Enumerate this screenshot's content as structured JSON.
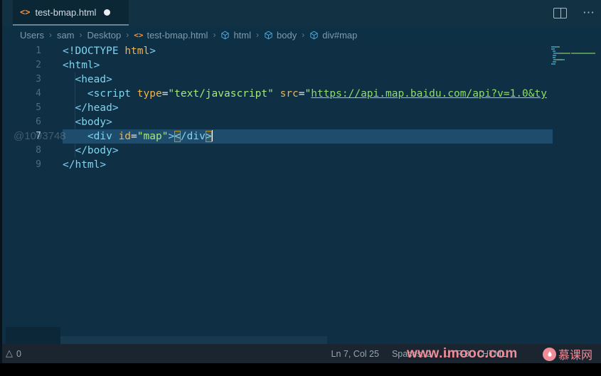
{
  "tab": {
    "title": "test-bmap.html",
    "modified": true
  },
  "editor_actions": {
    "split_label": "Split Editor",
    "more_label": "More Actions"
  },
  "breadcrumb": {
    "items": [
      {
        "label": "Users",
        "icon": null
      },
      {
        "label": "sam",
        "icon": null
      },
      {
        "label": "Desktop",
        "icon": null
      },
      {
        "label": "test-bmap.html",
        "icon": "code"
      },
      {
        "label": "html",
        "icon": "cube"
      },
      {
        "label": "body",
        "icon": "cube"
      },
      {
        "label": "div#map",
        "icon": "cube"
      }
    ],
    "separator": "›"
  },
  "editor": {
    "current_line": 7,
    "lines": [
      {
        "num": 1,
        "tokens": [
          {
            "t": "<!DOCTYPE ",
            "c": "tag"
          },
          {
            "t": "html",
            "c": "attr"
          },
          {
            "t": ">",
            "c": "tag"
          }
        ]
      },
      {
        "num": 2,
        "tokens": [
          {
            "t": "<html>",
            "c": "tag"
          }
        ]
      },
      {
        "num": 3,
        "tokens": [
          {
            "t": "  ",
            "c": "plain"
          },
          {
            "t": "<head>",
            "c": "tag"
          }
        ]
      },
      {
        "num": 4,
        "tokens": [
          {
            "t": "    ",
            "c": "plain"
          },
          {
            "t": "<script ",
            "c": "tag"
          },
          {
            "t": "type",
            "c": "attr"
          },
          {
            "t": "=",
            "c": "eq"
          },
          {
            "t": "\"text/javascript\"",
            "c": "str"
          },
          {
            "t": " ",
            "c": "plain"
          },
          {
            "t": "src",
            "c": "attr"
          },
          {
            "t": "=",
            "c": "eq"
          },
          {
            "t": "\"",
            "c": "str"
          },
          {
            "t": "https://api.map.baidu.com/api?v=1.0&ty",
            "c": "link"
          }
        ]
      },
      {
        "num": 5,
        "tokens": [
          {
            "t": "  ",
            "c": "plain"
          },
          {
            "t": "</head>",
            "c": "tag"
          }
        ]
      },
      {
        "num": 6,
        "tokens": [
          {
            "t": "  ",
            "c": "plain"
          },
          {
            "t": "<body>",
            "c": "tag"
          }
        ]
      },
      {
        "num": 7,
        "tokens": [
          {
            "t": "    ",
            "c": "plain"
          },
          {
            "t": "<div ",
            "c": "tag"
          },
          {
            "t": "id",
            "c": "attr"
          },
          {
            "t": "=",
            "c": "eq"
          },
          {
            "t": "\"map\"",
            "c": "str"
          },
          {
            "t": ">",
            "c": "tag"
          },
          {
            "t": "<",
            "c": "bracket"
          },
          {
            "t": "/div",
            "c": "tag"
          },
          {
            "t": ">",
            "c": "bracket"
          },
          {
            "t": "",
            "c": "cursor"
          }
        ]
      },
      {
        "num": 8,
        "tokens": [
          {
            "t": "  ",
            "c": "plain"
          },
          {
            "t": "</body>",
            "c": "tag"
          }
        ]
      },
      {
        "num": 9,
        "tokens": [
          {
            "t": "</html>",
            "c": "tag"
          }
        ]
      }
    ]
  },
  "status_bar": {
    "problems": "0",
    "position": "Ln 7, Col 25",
    "indent": "Spaces: 2",
    "encoding": "UTF-8",
    "language": "HTML"
  },
  "watermarks": {
    "editor_id": "@1093748",
    "site": "www.imooc.com",
    "brand": "慕课网"
  },
  "colors": {
    "editor_bg": "#0e2f44",
    "tabbar_bg": "#123143",
    "active_tab_bg": "#0b2634",
    "statusbar_bg": "#1a2530",
    "current_line_bg": "#1e4c6d",
    "tag_cyan": "#7fd4ee",
    "attr_yellow": "#f0b44c",
    "string_green": "#a3e878",
    "link_green": "#8edd66",
    "bracket_match_gold": "#b99320",
    "file_icon_orange": "#e8934a",
    "symbol_icon_blue": "#4ea3d8",
    "watermark_pink": "#ef8d98"
  },
  "token_minimap_colors": {
    "tag": "#4fb4d4",
    "attr": "#c79a3e",
    "str": "#7ac75a",
    "link": "#7ac75a",
    "eq": "#9fb4bf",
    "plain": "#0000",
    "bracket": "#4fb4d4",
    "cursor": "#0000"
  }
}
